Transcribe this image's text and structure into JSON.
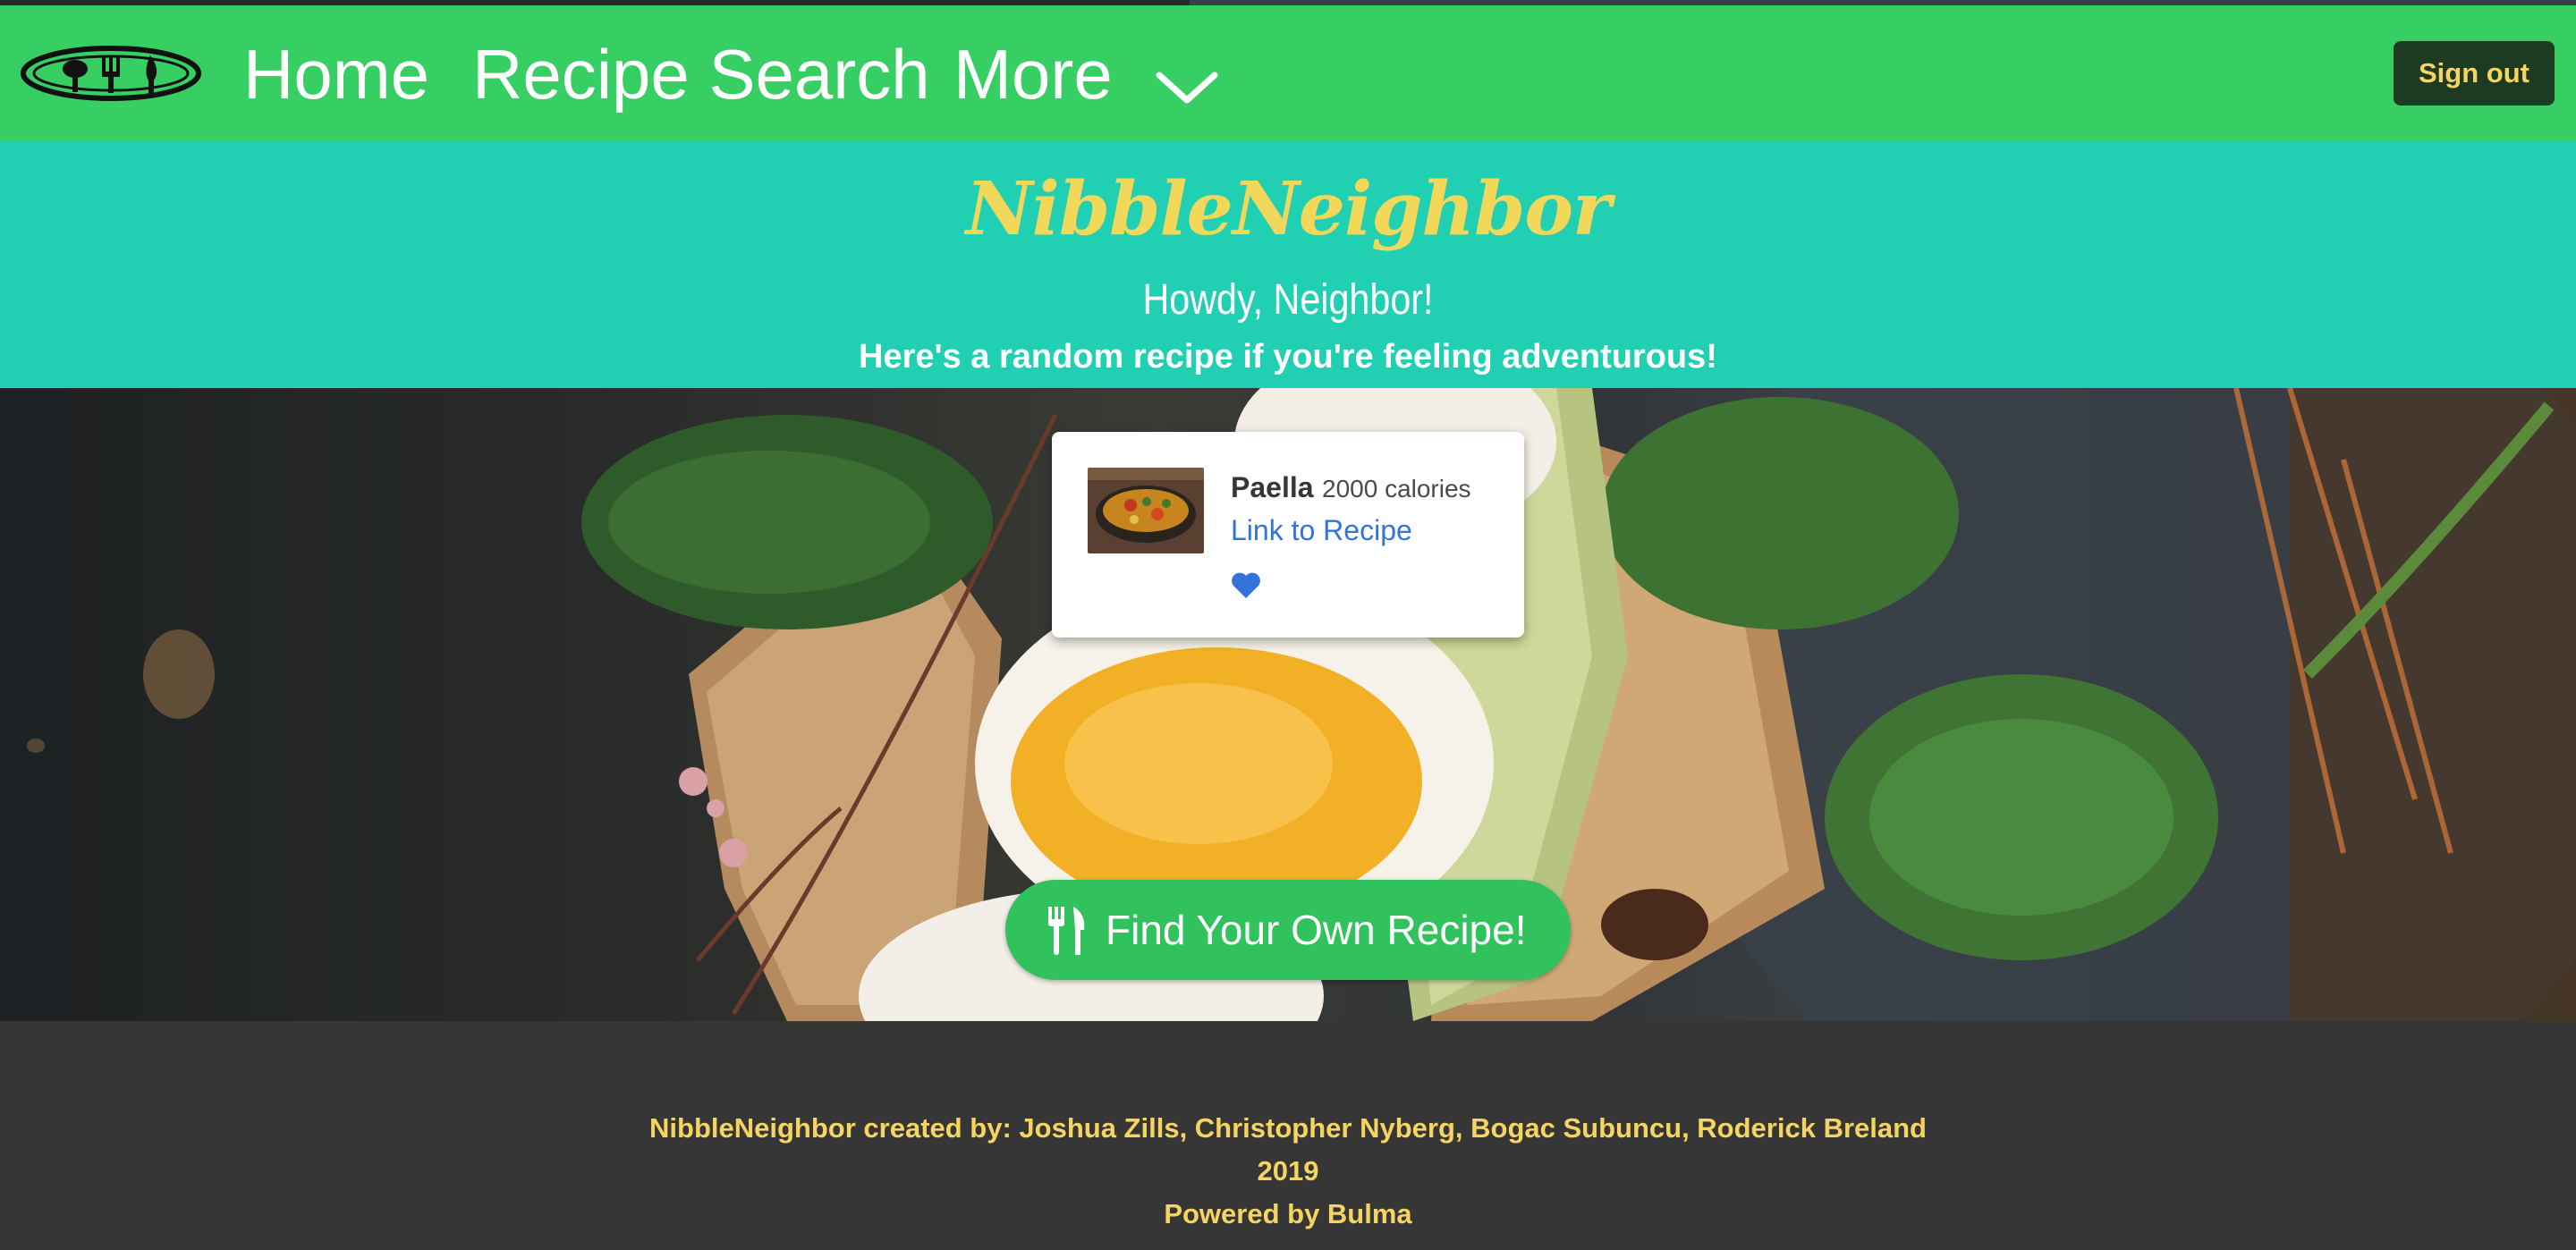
{
  "nav": {
    "logo_icon": "plate-utensils-logo-icon",
    "home": "Home",
    "recipe_search": "Recipe Search",
    "more": "More",
    "more_icon": "chevron-down-icon",
    "sign_out": "Sign out"
  },
  "hero": {
    "brand": "NibbleNeighbor",
    "greeting": "Howdy, Neighbor!",
    "tagline": "Here's a random recipe if you're feeling adventurous!"
  },
  "recipe_card": {
    "name": "Paella",
    "calories": "2000 calories",
    "link_text": "Link to Recipe",
    "favorite_icon": "heart-icon"
  },
  "cta": {
    "label": "Find Your Own Recipe!",
    "icon": "utensils-icon"
  },
  "footer": {
    "credits": "NibbleNeighbor created by: Joshua Zills, Christopher Nyberg, Bogac Subuncu, Roderick Breland",
    "year": "2019",
    "powered_by": "Powered by Bulma"
  },
  "colors": {
    "navbar": "#37cf64",
    "hero": "#21d0b2",
    "brand_text": "#f2d85a",
    "footer_bg": "#363636",
    "footer_text": "#f5d560",
    "link": "#3273dc",
    "cta": "#31c25d",
    "signout_bg": "#1d3b22"
  }
}
